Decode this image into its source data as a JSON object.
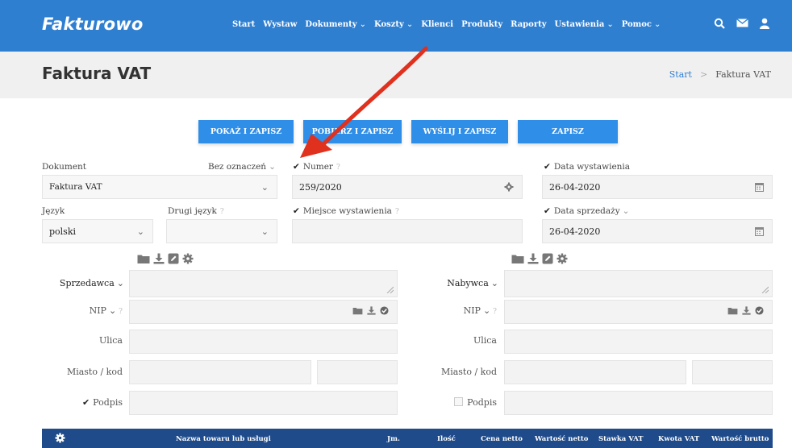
{
  "app": {
    "logo": "Fakturowo"
  },
  "nav": {
    "items": [
      {
        "label": "Start",
        "dropdown": false
      },
      {
        "label": "Wystaw",
        "dropdown": false
      },
      {
        "label": "Dokumenty",
        "dropdown": true
      },
      {
        "label": "Koszty",
        "dropdown": true
      },
      {
        "label": "Klienci",
        "dropdown": false
      },
      {
        "label": "Produkty",
        "dropdown": false
      },
      {
        "label": "Raporty",
        "dropdown": false
      },
      {
        "label": "Ustawienia",
        "dropdown": true
      },
      {
        "label": "Pomoc",
        "dropdown": true
      }
    ],
    "icons": [
      "search-icon",
      "envelope-icon",
      "user-icon"
    ]
  },
  "header": {
    "title": "Faktura VAT",
    "breadcrumb": {
      "start": "Start",
      "sep": ">",
      "current": "Faktura VAT"
    }
  },
  "actions": {
    "show_save": "POKAŻ I ZAPISZ",
    "print_save": "POBIERZ I ZAPISZ",
    "send_save": "WYŚLIJ I ZAPISZ",
    "save": "ZAPISZ"
  },
  "form": {
    "dokument": {
      "label": "Dokument",
      "value": "Faktura VAT",
      "marking": "Bez oznaczeń"
    },
    "numer": {
      "label": "Numer",
      "value": "259/2020"
    },
    "data_wystawienia": {
      "label": "Data wystawienia",
      "value": "26-04-2020"
    },
    "jezyk": {
      "label": "Język",
      "value": "polski"
    },
    "drugi_jezyk": {
      "label": "Drugi język",
      "value": ""
    },
    "miejsce": {
      "label": "Miejsce wystawienia",
      "value": ""
    },
    "data_sprzedazy": {
      "label": "Data sprzedaży",
      "value": "26-04-2020"
    }
  },
  "seller": {
    "label": "Sprzedawca",
    "nip_label": "NIP",
    "ulica_label": "Ulica",
    "miasto_label": "Miasto / kod",
    "podpis_label": "Podpis",
    "podpis_checked": true
  },
  "buyer": {
    "label": "Nabywca",
    "nip_label": "NIP",
    "ulica_label": "Ulica",
    "miasto_label": "Miasto / kod",
    "podpis_label": "Podpis",
    "podpis_checked": false
  },
  "table": {
    "columns": [
      "Nazwa towaru lub usługi",
      "Jm.",
      "Ilość",
      "Cena netto",
      "Wartość netto",
      "Stawka VAT",
      "Kwota VAT",
      "Wartość brutto"
    ]
  },
  "colors": {
    "brand": "#2f7fd1",
    "button": "#2f8ee8",
    "table_header": "#1f4b8a",
    "arrow": "#e0301e"
  }
}
